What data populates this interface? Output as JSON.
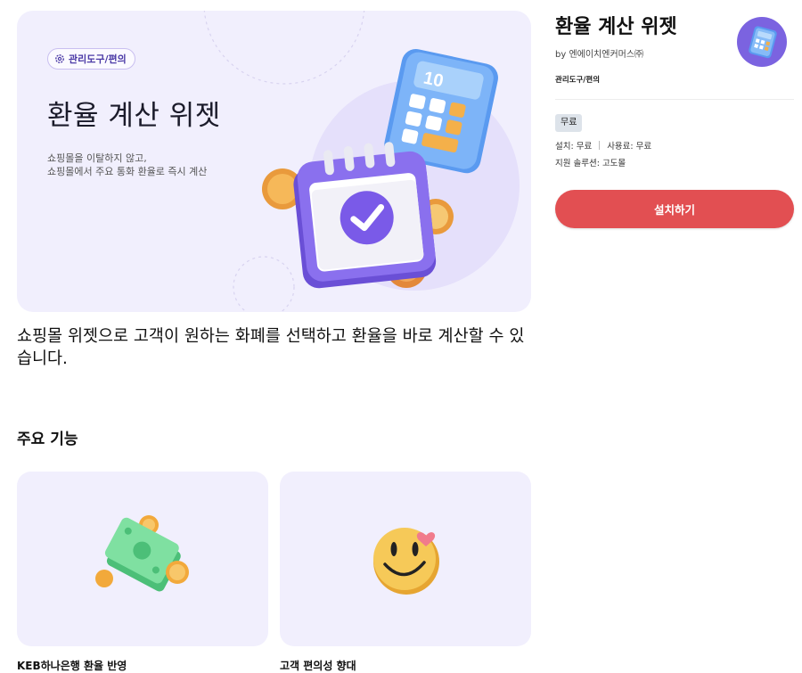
{
  "hero": {
    "badge": "관리도구/편의",
    "badge_icon": "gear-icon",
    "title": "환율 계산 위젯",
    "desc_line1": "쇼핑몰을 이탈하지 않고,",
    "desc_line2": "쇼핑몰에서 주요 통화 환율로 즉시 계산",
    "calculator_display": "10"
  },
  "summary": "쇼핑몰 위젯으로 고객이 원하는 화폐를 선택하고 환율을 바로 계산할 수 있습니다.",
  "features": {
    "section_title": "주요 기능",
    "items": [
      {
        "label": "KEB하나은행 환율 반영",
        "icon": "money-icon"
      },
      {
        "label": "고객 편의성 향대",
        "icon": "smiley-icon"
      }
    ]
  },
  "sidebar": {
    "title": "환율 계산 위젯",
    "by": "by 엔에이치엔커머스㈜",
    "category": "관리도구/편의",
    "price_badge": "무료",
    "install_fee": "설치: 무료",
    "usage_fee": "사용료: 무료",
    "support": "지원 솔루션: 고도몰",
    "install_button": "설치하기",
    "app_icon": "calculator-icon"
  },
  "colors": {
    "hero_bg": "#f1effd",
    "accent_purple": "#7b63e0",
    "install_red": "#e24f52"
  }
}
